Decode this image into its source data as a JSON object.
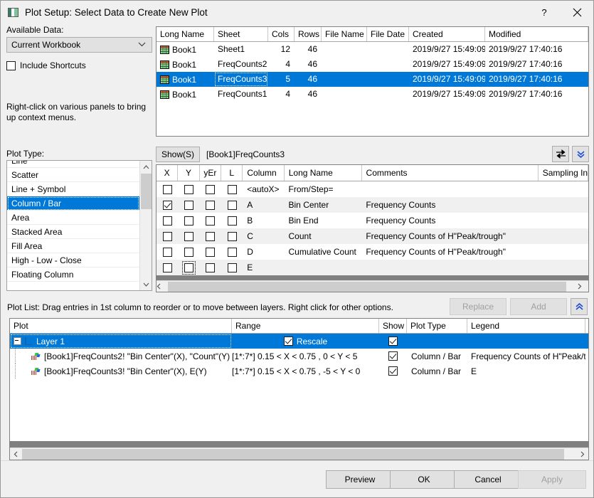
{
  "window": {
    "title": "Plot Setup: Select Data to Create New Plot",
    "icon": "plot-setup-icon",
    "help_label": "?",
    "close_label": "✕"
  },
  "left_panel": {
    "available_data_label": "Available Data:",
    "source_combo": {
      "value": "Current Workbook",
      "icon": "chevron-down-icon"
    },
    "include_shortcuts": {
      "label": "Include Shortcuts",
      "checked": false
    },
    "hint": "Right-click on various panels to bring up context menus.",
    "plot_type_label": "Plot Type:",
    "plot_types": [
      {
        "label": "Line",
        "selected": false
      },
      {
        "label": "Scatter",
        "selected": false
      },
      {
        "label": "Line + Symbol",
        "selected": false
      },
      {
        "label": "Column / Bar",
        "selected": true
      },
      {
        "label": "Area",
        "selected": false
      },
      {
        "label": "Stacked Area",
        "selected": false
      },
      {
        "label": "Fill Area",
        "selected": false
      },
      {
        "label": "High - Low - Close",
        "selected": false
      },
      {
        "label": "Floating Column",
        "selected": false
      }
    ],
    "scroll_up_icon": "chevron-up-icon",
    "scroll_down_icon": "chevron-down-icon"
  },
  "data_table": {
    "headers": [
      "Long Name",
      "Sheet",
      "Cols",
      "Rows",
      "File Name",
      "File Date",
      "Created",
      "Modified"
    ],
    "rows": [
      {
        "long_name": "Book1",
        "sheet": "Sheet1",
        "cols": "12",
        "rows": "46",
        "file_name": "",
        "file_date": "",
        "created": "2019/9/27 15:49:09",
        "modified": "2019/9/27 17:40:16",
        "selected": false
      },
      {
        "long_name": "Book1",
        "sheet": "FreqCounts2",
        "cols": "4",
        "rows": "46",
        "file_name": "",
        "file_date": "",
        "created": "2019/9/27 15:49:09",
        "modified": "2019/9/27 17:40:16",
        "selected": false
      },
      {
        "long_name": "Book1",
        "sheet": "FreqCounts3",
        "cols": "5",
        "rows": "46",
        "file_name": "",
        "file_date": "",
        "created": "2019/9/27 15:49:09",
        "modified": "2019/9/27 17:40:16",
        "selected": true
      },
      {
        "long_name": "Book1",
        "sheet": "FreqCounts1",
        "cols": "4",
        "rows": "46",
        "file_name": "",
        "file_date": "",
        "created": "2019/9/27 15:49:09",
        "modified": "2019/9/27 17:40:16",
        "selected": false
      }
    ]
  },
  "show_bar": {
    "show_button": "Show(S)",
    "path": "[Book1]FreqCounts3",
    "swap_icon": "swap-arrows-icon",
    "expand_icon": "double-chevron-down-icon"
  },
  "column_grid": {
    "headers": [
      "X",
      "Y",
      "yEr",
      "L",
      "Column",
      "Long Name",
      "Comments",
      "Sampling Inte"
    ],
    "rows": [
      {
        "x": false,
        "y": false,
        "yer": false,
        "l": false,
        "column": "<autoX>",
        "long_name": "From/Step=",
        "comments": "",
        "sampling": ""
      },
      {
        "x": true,
        "y": false,
        "yer": false,
        "l": false,
        "column": "A",
        "long_name": "Bin Center",
        "comments": "Frequency Counts",
        "sampling": ""
      },
      {
        "x": false,
        "y": false,
        "yer": false,
        "l": false,
        "column": "B",
        "long_name": "Bin End",
        "comments": "Frequency Counts",
        "sampling": ""
      },
      {
        "x": false,
        "y": false,
        "yer": false,
        "l": false,
        "column": "C",
        "long_name": "Count",
        "comments": "Frequency Counts of H\"Peak/trough\"",
        "sampling": ""
      },
      {
        "x": false,
        "y": false,
        "yer": false,
        "l": false,
        "column": "D",
        "long_name": "Cumulative Count",
        "comments": "Frequency Counts of H\"Peak/trough\"",
        "sampling": ""
      },
      {
        "x": false,
        "y": false,
        "yer": false,
        "l": false,
        "column": "E",
        "long_name": "",
        "comments": "",
        "sampling": "",
        "y_focused": true
      }
    ],
    "scroll_left_icon": "chevron-left-icon",
    "scroll_right_icon": "chevron-right-icon"
  },
  "plot_list": {
    "label": "Plot List: Drag entries in 1st column to reorder or to move between layers. Right click for other options.",
    "replace_button": "Replace",
    "add_button": "Add",
    "collapse_icon": "double-chevron-up-icon",
    "headers": [
      "Plot",
      "Range",
      "Show",
      "Plot Type",
      "Legend"
    ],
    "layer": {
      "name": "Layer 1",
      "rescale_label": "Rescale",
      "rescale_checked": true,
      "show_checked": true,
      "selected": true,
      "expander_icon": "minus-expander-icon",
      "layer_icon": "layer-axes-icon"
    },
    "plots": [
      {
        "plot": "[Book1]FreqCounts2! \"Bin Center\"(X), \"Count\"(Y)",
        "range": "[1*:7*]  0.15 < X < 0.75 , 0 < Y < 5",
        "show_checked": true,
        "plot_type": "Column / Bar",
        "legend": "Frequency Counts of H\"Peak/trou",
        "icon": "plot-curve-icon"
      },
      {
        "plot": "[Book1]FreqCounts3! \"Bin Center\"(X), E(Y)",
        "range": "[1*:7*]  0.15 < X < 0.75 , -5 < Y < 0",
        "show_checked": true,
        "plot_type": "Column / Bar",
        "legend": "E",
        "icon": "plot-curve-icon"
      }
    ],
    "scroll_left_icon": "chevron-left-icon",
    "scroll_right_icon": "chevron-right-icon"
  },
  "footer": {
    "buttons": [
      {
        "label": "Preview",
        "disabled": false
      },
      {
        "label": "OK",
        "disabled": false
      },
      {
        "label": "Cancel",
        "disabled": false
      },
      {
        "label": "Apply",
        "disabled": true
      }
    ]
  },
  "colors": {
    "selection_blue": "#0078d7",
    "dialog_bg": "#f0f0f0",
    "grid_alt_row": "#f0f0f0"
  }
}
